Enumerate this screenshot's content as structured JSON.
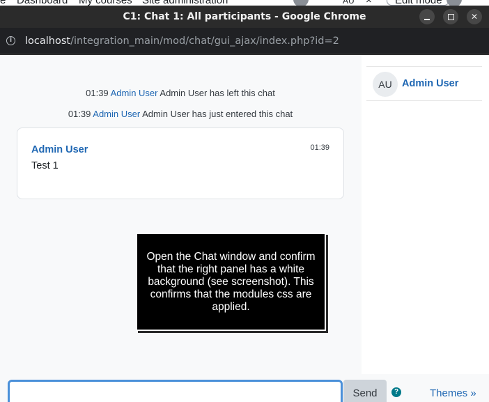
{
  "background_page": {
    "nav_items": [
      "e",
      "Dashboard",
      "My courses",
      "Site administration"
    ],
    "avatar_initials": "AU",
    "close_glyph": "×",
    "edit_mode_label": "Edit mode"
  },
  "window": {
    "title": "C1: Chat 1: All participants - Google Chrome",
    "info_icon": "i",
    "url_host": "localhost",
    "url_path": "/integration_main/mod/chat/gui_ajax/index.php?id=2"
  },
  "chat": {
    "system_messages": [
      {
        "time": "01:39",
        "user": "Admin User",
        "text": "Admin User has left this chat"
      },
      {
        "time": "01:39",
        "user": "Admin User",
        "text": "Admin User has just entered this chat"
      }
    ],
    "message": {
      "author": "Admin User",
      "time": "01:39",
      "text": "Test 1"
    },
    "users": [
      {
        "initials": "AU",
        "name": "Admin User"
      }
    ],
    "tooltip": "Open the Chat window and confirm that the right panel has a white background (see screenshot). This confirms that the modules css are applied.",
    "input": {
      "value": "",
      "placeholder": ""
    },
    "send_label": "Send",
    "help_glyph": "?",
    "themes_label": "Themes »"
  }
}
